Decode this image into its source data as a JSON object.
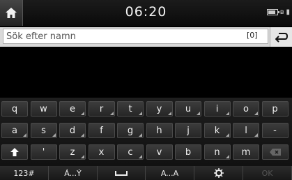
{
  "status": {
    "time": "06:20"
  },
  "search": {
    "placeholder": "Sök efter namn",
    "value": "",
    "count": "[0]"
  },
  "keyboard": {
    "rows": [
      [
        {
          "label": "q",
          "alt": false
        },
        {
          "label": "w",
          "alt": false
        },
        {
          "label": "e",
          "alt": true
        },
        {
          "label": "r",
          "alt": true
        },
        {
          "label": "t",
          "alt": true
        },
        {
          "label": "y",
          "alt": true
        },
        {
          "label": "u",
          "alt": true
        },
        {
          "label": "i",
          "alt": true
        },
        {
          "label": "o",
          "alt": true
        },
        {
          "label": "p",
          "alt": false
        }
      ],
      [
        {
          "label": "a",
          "alt": true
        },
        {
          "label": "s",
          "alt": true
        },
        {
          "label": "d",
          "alt": true
        },
        {
          "label": "f",
          "alt": false
        },
        {
          "label": "g",
          "alt": true
        },
        {
          "label": "h",
          "alt": false
        },
        {
          "label": "j",
          "alt": false
        },
        {
          "label": "k",
          "alt": true
        },
        {
          "label": "l",
          "alt": true
        },
        {
          "label": "-",
          "alt": false
        }
      ],
      [
        {
          "label": "",
          "icon": "shift-icon",
          "alt": false
        },
        {
          "label": "'",
          "alt": false
        },
        {
          "label": "z",
          "alt": true
        },
        {
          "label": "x",
          "alt": false
        },
        {
          "label": "c",
          "alt": true
        },
        {
          "label": "v",
          "alt": false
        },
        {
          "label": "b",
          "alt": false
        },
        {
          "label": "n",
          "alt": true
        },
        {
          "label": "m",
          "alt": false
        },
        {
          "label": "",
          "icon": "backspace-icon",
          "alt": false
        }
      ]
    ],
    "function_row": [
      {
        "label": "123#",
        "name": "numbers-key",
        "disabled": false
      },
      {
        "label": "Á...Ý",
        "name": "accented-upper-key",
        "disabled": false
      },
      {
        "label": "",
        "icon": "space-icon",
        "name": "space-key",
        "disabled": false
      },
      {
        "label": "A...A",
        "name": "accented-key",
        "disabled": false
      },
      {
        "label": "",
        "icon": "settings-icon",
        "name": "settings-key",
        "disabled": false
      },
      {
        "label": "OK",
        "name": "ok-key",
        "disabled": true
      }
    ]
  }
}
